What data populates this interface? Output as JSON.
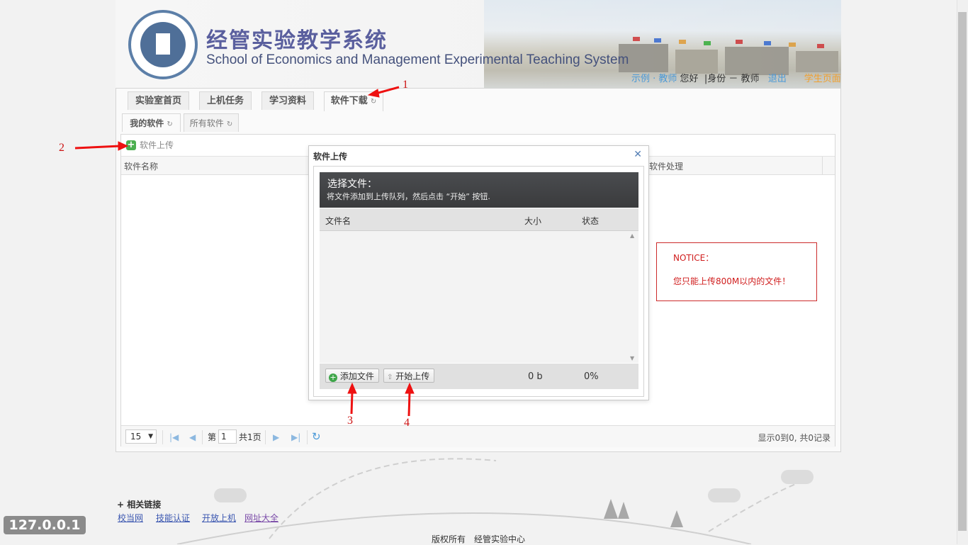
{
  "header": {
    "title_cn": "经管实验教学系统",
    "title_en": "School of Economics and Management Experimental Teaching System",
    "user_link": "示例 · 教师",
    "greeting": "您好",
    "role": "|身份 － 教师",
    "logout": "退出",
    "extra": "学生页面"
  },
  "main_tabs": [
    {
      "label": "实验室首页",
      "active": false
    },
    {
      "label": "上机任务",
      "active": false
    },
    {
      "label": "学习资料",
      "active": false
    },
    {
      "label": "软件下载",
      "active": true
    }
  ],
  "sub_tabs": [
    {
      "label": "我的软件",
      "active": true
    },
    {
      "label": "所有软件",
      "active": false
    }
  ],
  "toolbar": {
    "upload_label": "软件上传"
  },
  "grid": {
    "columns": [
      "软件名称",
      "软件处理"
    ],
    "pager": {
      "page_size": "15",
      "page_prefix": "第",
      "page_value": "1",
      "page_total": "共1页",
      "summary": "显示0到0, 共0记录"
    }
  },
  "dialog": {
    "title": "软件上传",
    "heading": "选择文件：",
    "subheading": "将文件添加到上传队列，然后点击 “开始” 按钮.",
    "columns": {
      "name": "文件名",
      "size": "大小",
      "status": "状态"
    },
    "add_button": "添加文件",
    "start_button": "开始上传",
    "total_size": "0 b",
    "progress": "0%"
  },
  "notice": {
    "title": "NOTICE：",
    "text": "您只能上传800M以内的文件！"
  },
  "annotations": [
    "1",
    "2",
    "3",
    "4"
  ],
  "footer": {
    "links_title": "+ 相关链接",
    "links": [
      "校当网",
      "技能认证",
      "开放上机",
      "网址大全"
    ],
    "copyright": "版权所有　经管实验中心"
  },
  "ip_badge": "127.0.0.1",
  "colors": {
    "accent": "#4c9ad8",
    "notice": "#d01d1d",
    "annotation": "#cc1111"
  }
}
